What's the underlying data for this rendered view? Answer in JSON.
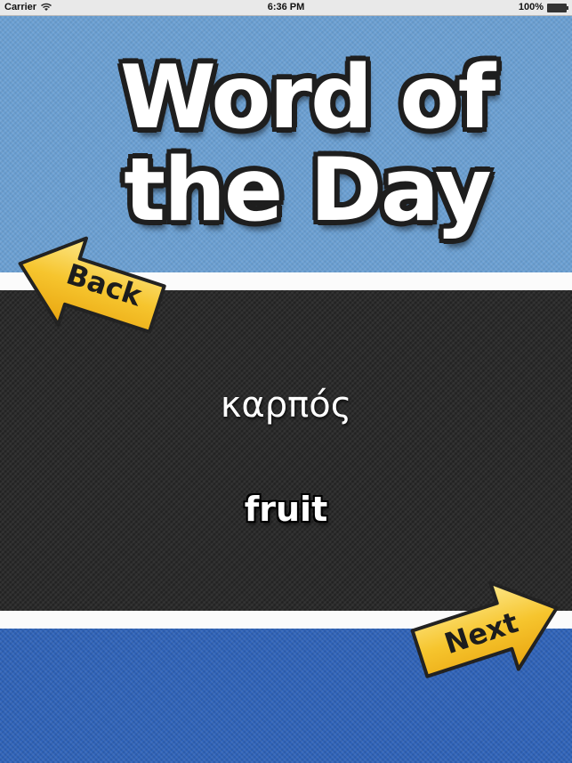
{
  "status_bar": {
    "carrier": "Carrier",
    "time": "6:36 PM",
    "battery": "100%"
  },
  "title": {
    "line1": "Word of",
    "line2": "the Day"
  },
  "word": {
    "greek": "καρπός",
    "english": "fruit"
  },
  "nav": {
    "back_label": "Back",
    "next_label": "Next"
  },
  "colors": {
    "top_panel": "#6a9fd2",
    "middle_panel": "#2d2d2d",
    "bottom_panel": "#2f63b9",
    "arrow_fill": "#f6c52e"
  }
}
